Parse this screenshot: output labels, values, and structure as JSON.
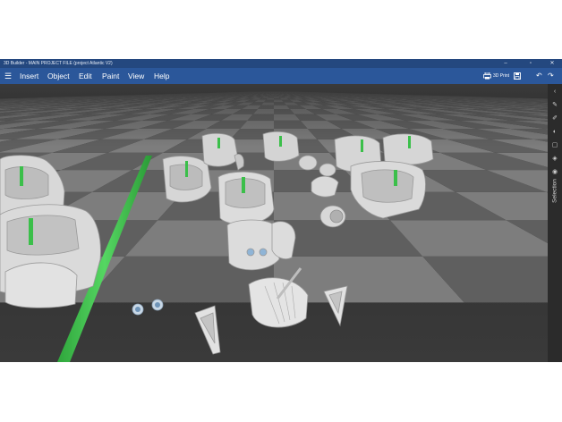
{
  "app": {
    "window_title": "3D Builder - MAIN PROJECT FILE (project Atlantic V2)",
    "window_controls": {
      "minimize": "–",
      "maximize": "▫",
      "close": "✕"
    }
  },
  "menu": {
    "hamburger_icon": "☰",
    "items": [
      "Insert",
      "Object",
      "Edit",
      "Paint",
      "View",
      "Help"
    ],
    "print_label": "3D Print",
    "undo_icon": "↶",
    "redo_icon": "↷",
    "save_icon": "save-icon",
    "print_icon": "printer-icon"
  },
  "sidebar": {
    "collapse_icon": "‹",
    "tools": [
      "✎",
      "✐",
      "◐",
      "▢",
      "◈",
      "◉"
    ],
    "selection_label": "Selection"
  },
  "colors": {
    "title_bar": "#24487f",
    "menu_bar": "#2b579a",
    "floor_light": "#7d7d7d",
    "floor_dark": "#5f5f5f",
    "part_fill": "#d6d6d6",
    "selection_green": "#3bbf4a"
  }
}
